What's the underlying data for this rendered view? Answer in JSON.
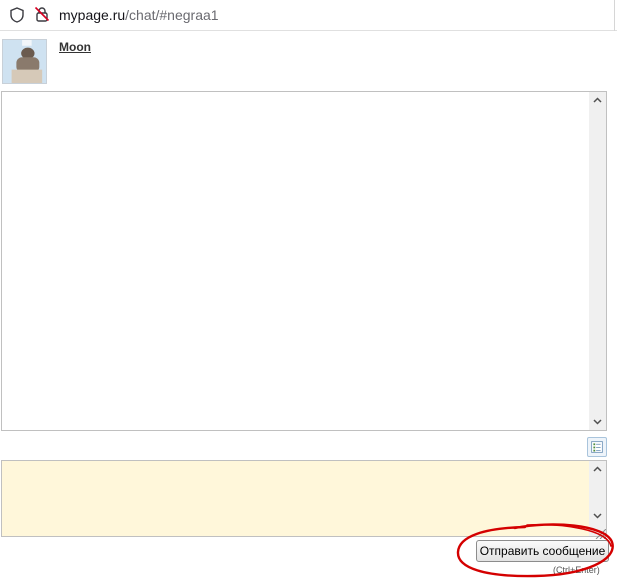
{
  "browser": {
    "url_host": "mypage.ru",
    "url_path": "/chat/#negraa1"
  },
  "chat": {
    "contact_name": "Moon",
    "message_log_scroll_up_icon": "chevron-up-icon",
    "message_log_scroll_down_icon": "chevron-down-icon"
  },
  "composer": {
    "value": "",
    "background_color": "#fff7da",
    "send_label": "Отправить сообщение",
    "shortcut_hint": "(Ctrl+Enter)"
  },
  "annotation": {
    "highlight_color": "#d40000"
  }
}
